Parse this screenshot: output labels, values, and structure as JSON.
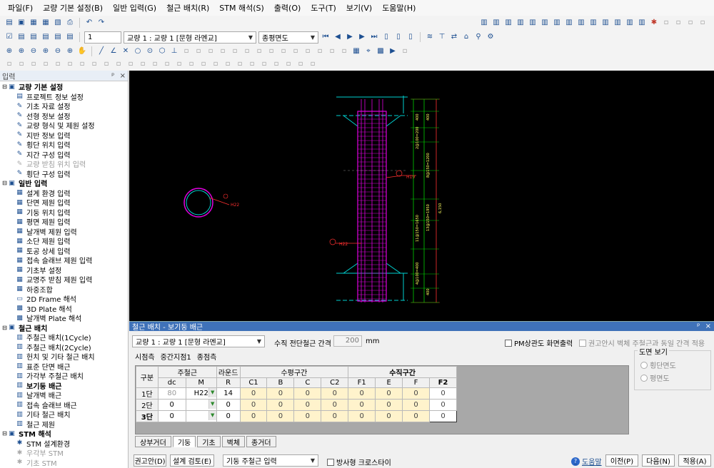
{
  "menu": [
    "파일(F)",
    "교량 기본 설정(B)",
    "일반 입력(G)",
    "철근 배치(R)",
    "STM 해석(S)",
    "출력(O)",
    "도구(T)",
    "보기(V)",
    "도움말(H)"
  ],
  "toolbar2": {
    "page_value": "1",
    "bridge_combo": "교량 1 : 교량 1 [문형 라멘교]",
    "view_combo": "종평면도"
  },
  "left_panel": {
    "title": "입력",
    "pin": "ᵖ",
    "close": "×",
    "groups": [
      {
        "label": "교량 기본 설정",
        "items": [
          {
            "label": "프로젝트 정보 설정",
            "icon": "doc-icon",
            "state": "normal"
          },
          {
            "label": "기초 자료 설정",
            "icon": "pencil-icon",
            "state": "normal"
          },
          {
            "label": "선형 정보 설정",
            "icon": "pencil-icon",
            "state": "normal"
          },
          {
            "label": "교량 형식 및 제원 설정",
            "icon": "pencil-icon",
            "state": "normal"
          },
          {
            "label": "지반 정보 입력",
            "icon": "pencil-icon",
            "state": "normal"
          },
          {
            "label": "횡단 위치 입력",
            "icon": "pencil-icon",
            "state": "normal"
          },
          {
            "label": "지간 구성 입력",
            "icon": "pencil-icon",
            "state": "normal"
          },
          {
            "label": "교량 받침 위치 입력",
            "icon": "pencil-icon",
            "state": "disabled"
          },
          {
            "label": "횡단 구성 입력",
            "icon": "pencil-icon",
            "state": "normal"
          }
        ]
      },
      {
        "label": "일반 입력",
        "items": [
          {
            "label": "설계 환경 입력",
            "icon": "grid-icon",
            "state": "normal"
          },
          {
            "label": "단면 제원 입력",
            "icon": "grid-icon",
            "state": "normal"
          },
          {
            "label": "기둥 위치 입력",
            "icon": "grid-icon",
            "state": "normal"
          },
          {
            "label": "평면 제원 입력",
            "icon": "grid-icon",
            "state": "normal"
          },
          {
            "label": "날개벽 제원 입력",
            "icon": "grid-icon",
            "state": "normal"
          },
          {
            "label": "소단 제원 입력",
            "icon": "grid-icon",
            "state": "normal"
          },
          {
            "label": "토공 상세 입력",
            "icon": "grid-icon",
            "state": "normal"
          },
          {
            "label": "접속 슬래브 제원 입력",
            "icon": "grid-icon",
            "state": "normal"
          },
          {
            "label": "기초부 설정",
            "icon": "grid-icon",
            "state": "normal"
          },
          {
            "label": "교명주 받침 제원 입력",
            "icon": "grid-icon",
            "state": "normal"
          },
          {
            "label": "하중조합",
            "icon": "grid-icon",
            "state": "normal"
          },
          {
            "label": "2D Frame 해석",
            "icon": "frame-icon",
            "state": "normal"
          },
          {
            "label": "3D Plate 해석",
            "icon": "plate-icon",
            "state": "normal"
          },
          {
            "label": "날개벽 Plate 해석",
            "icon": "plate-icon",
            "state": "normal"
          }
        ]
      },
      {
        "label": "철근 배치",
        "items": [
          {
            "label": "주철근 배치(1Cycle)",
            "icon": "rebar-icon",
            "state": "normal"
          },
          {
            "label": "주철근 배치(2Cycle)",
            "icon": "rebar-icon",
            "state": "normal"
          },
          {
            "label": "헌치 및 기타 철근 배치",
            "icon": "rebar-icon",
            "state": "normal"
          },
          {
            "label": "표준 단면 배근",
            "icon": "rebar-icon",
            "state": "normal"
          },
          {
            "label": "가각부 주철근 배치",
            "icon": "rebar-icon",
            "state": "normal"
          },
          {
            "label": "보기둥 배근",
            "icon": "rebar-icon",
            "state": "selected"
          },
          {
            "label": "날개벽 배근",
            "icon": "rebar-icon",
            "state": "normal"
          },
          {
            "label": "접속 슬래브 배근",
            "icon": "rebar-icon",
            "state": "normal"
          },
          {
            "label": "기타 철근 배치",
            "icon": "rebar-icon",
            "state": "normal"
          },
          {
            "label": "철근 제원",
            "icon": "rebar-icon",
            "state": "normal"
          }
        ]
      },
      {
        "label": "STM 해석",
        "items": [
          {
            "label": "STM 설계환경",
            "icon": "stm-icon",
            "state": "normal"
          },
          {
            "label": "우각부 STM",
            "icon": "stm-icon",
            "state": "disabled"
          },
          {
            "label": "기초 STM",
            "icon": "stm-icon",
            "state": "disabled"
          }
        ]
      }
    ]
  },
  "drawing": {
    "circle_labels": [
      "H22"
    ],
    "column_labels": [
      "H19",
      "H22"
    ],
    "dim_labels": [
      "400",
      "400",
      "2@100=200",
      "8@150=1200",
      "13@150=1950",
      "11@150=1650",
      "4@100=400",
      "400",
      "6,150"
    ]
  },
  "dialog": {
    "title": "철근 배치 - 보기둥 배근",
    "pin": "ᵖ",
    "close": "×",
    "bridge_combo": "교량 1 : 교량 1 [문형 라멘교]",
    "spacing_label": "수직 전단철근 간격",
    "spacing_value": "200",
    "spacing_unit": "mm",
    "pm_label": "PM상관도 화면출력",
    "recommend_label": "권고안시 벽체 주철근과 동일 간격 적용",
    "view_group": "도면 보기",
    "view_opts": [
      "횡단면도",
      "평면도"
    ],
    "section_tabs": [
      "시점측",
      "중간지점1",
      "종점측"
    ],
    "table": {
      "h1": [
        "구분",
        "주철근",
        "라운드",
        "수평구간",
        "수직구간"
      ],
      "h2": [
        "dc",
        "M",
        "R",
        "C1",
        "B",
        "C",
        "C2",
        "F1",
        "E",
        "F",
        "F2"
      ],
      "rows": [
        {
          "label": "1단",
          "dc": "80",
          "m": "H22",
          "r": "14",
          "vals": [
            "0",
            "0",
            "0",
            "0",
            "0",
            "0",
            "0",
            "0"
          ]
        },
        {
          "label": "2단",
          "dc": "0",
          "m": "",
          "r": "0",
          "vals": [
            "0",
            "0",
            "0",
            "0",
            "0",
            "0",
            "0",
            "0"
          ]
        },
        {
          "label": "3단",
          "dc": "0",
          "m": "",
          "r": "0",
          "vals": [
            "0",
            "0",
            "0",
            "0",
            "0",
            "0",
            "0",
            "0"
          ]
        }
      ]
    },
    "bottom_tabs": [
      "상부거더",
      "기둥",
      "기초",
      "벽체",
      "종거더"
    ],
    "btn_recommend": "권고안(D)",
    "btn_review": "설계 검토(E)",
    "input_combo": "기둥 주철근 입력",
    "radial_label": "방사형 크로스타이",
    "help": "도움말",
    "btn_prev": "이전(P)",
    "btn_next": "다음(N)",
    "btn_apply": "적용(A)"
  }
}
